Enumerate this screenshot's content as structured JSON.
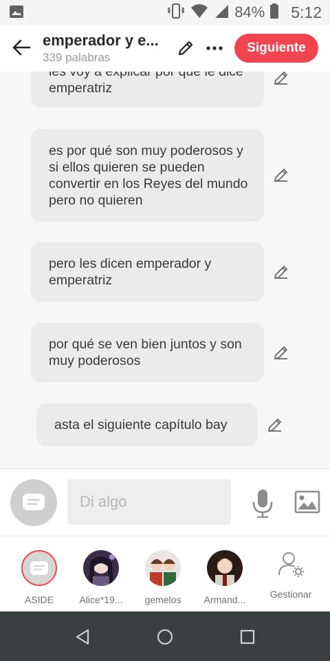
{
  "status_bar": {
    "battery": "84%",
    "time": "5:12"
  },
  "header": {
    "title": "emperador y e...",
    "subtitle": "339 palabras",
    "next_label": "Siguiente",
    "accent_color": "#f2444f"
  },
  "messages": [
    {
      "text": "les voy a explicar por qué le dice emperatriz"
    },
    {
      "text": "es por qué son muy poderosos y si ellos quieren se pueden convertir en los Reyes del mundo pero no quieren"
    },
    {
      "text": "pero les dicen emperador y emperatriz"
    },
    {
      "text": "por qué se ven bien juntos y son muy poderosos"
    },
    {
      "text": "asta el siguiente capítulo bay"
    }
  ],
  "input": {
    "placeholder": "Di algo"
  },
  "characters": [
    {
      "name": "ASIDE",
      "selected": true
    },
    {
      "name": "Alice*19..."
    },
    {
      "name": "gemelos"
    },
    {
      "name": "Armand..."
    }
  ],
  "manage_label": "Gestionar",
  "icons": {
    "back": "arrow-left-icon",
    "edit": "pencil-icon",
    "more": "more-horizontal-icon",
    "mic": "microphone-icon",
    "image": "image-icon",
    "manage": "user-settings-icon"
  }
}
